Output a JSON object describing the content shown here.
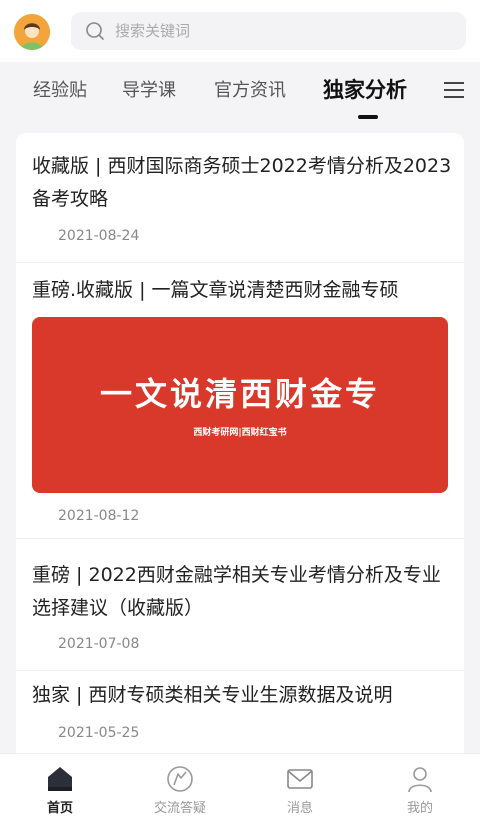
{
  "header": {
    "search_placeholder": "搜索关键词"
  },
  "tabs": [
    {
      "label": "经验贴"
    },
    {
      "label": "导学课"
    },
    {
      "label": "官方资讯"
    },
    {
      "label": "独家分析"
    }
  ],
  "active_tab": "独家分析",
  "articles": [
    {
      "title": "收藏版 | 西财国际商务硕士2022考情分析及2023备考攻略",
      "date": "2021-08-24"
    },
    {
      "title": "重磅.收藏版 | 一篇文章说清楚西财金融专硕",
      "date": "2021-08-12",
      "banner": {
        "title": "一文说清西财金专",
        "subtitle": "西财考研网|西财红宝书"
      }
    },
    {
      "title": "重磅 | 2022西财金融学相关专业考情分析及专业选择建议（收藏版）",
      "date": "2021-07-08"
    },
    {
      "title": "独家 | 西财专硕类相关专业生源数据及说明",
      "date": "2021-05-25"
    }
  ],
  "bottom_nav": [
    {
      "label": "首页",
      "icon": "home-icon"
    },
    {
      "label": "交流答疑",
      "icon": "qa-icon"
    },
    {
      "label": "消息",
      "icon": "mail-icon"
    },
    {
      "label": "我的",
      "icon": "user-icon"
    }
  ],
  "colors": {
    "accent": "#d9392b",
    "avatar": "#f3a43a"
  }
}
